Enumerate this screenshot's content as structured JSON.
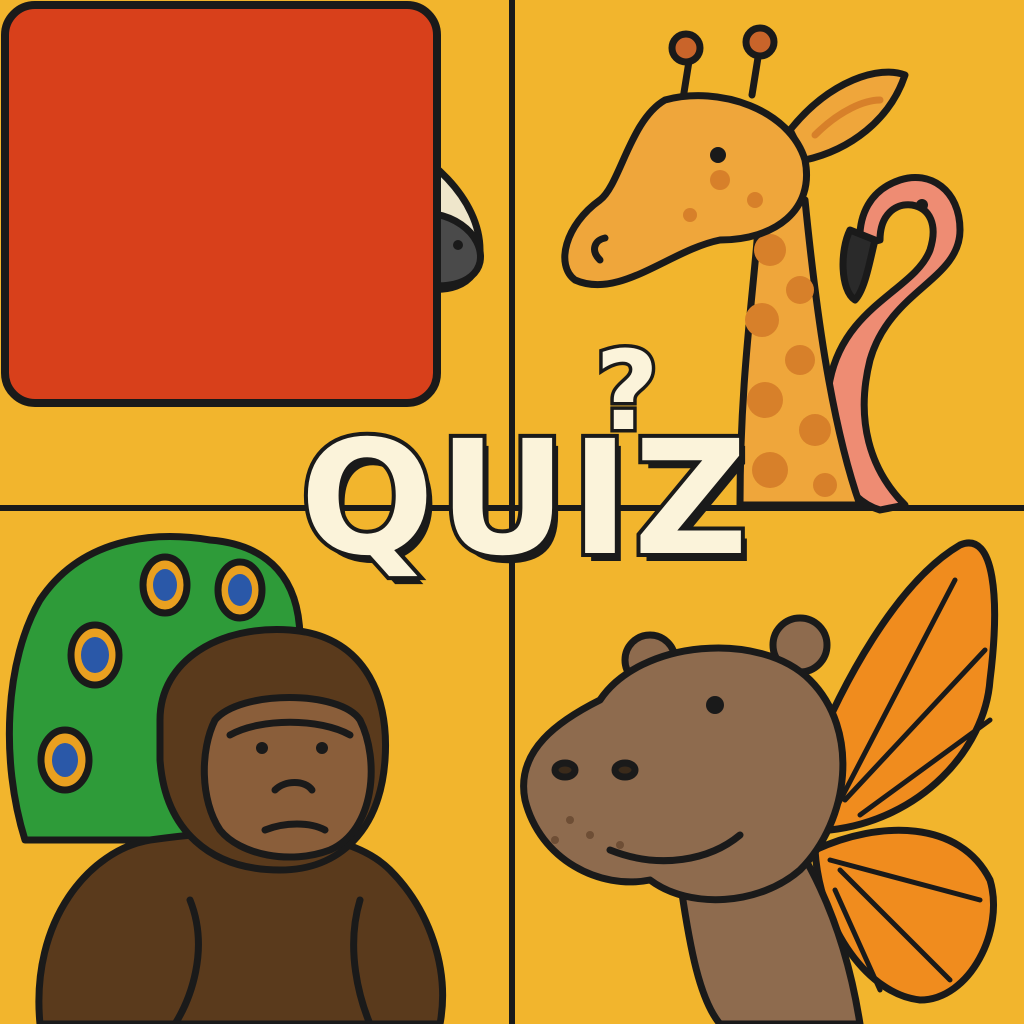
{
  "quiz": {
    "title": "QUIZ",
    "mark": "?"
  },
  "colors": {
    "background": "#F2B52D",
    "card": "#D8401B",
    "outline": "#1a1a1a",
    "lettering": "#FBF3DA"
  },
  "panels": [
    {
      "name": "zebra-fish-panel",
      "icon": "zebra-fish-icon"
    },
    {
      "name": "giraffe-flamingo-panel",
      "icon": "giraffe-flamingo-icon"
    },
    {
      "name": "gorilla-peacock-panel",
      "icon": "gorilla-peacock-icon"
    },
    {
      "name": "hippo-butterfly-panel",
      "icon": "hippo-butterfly-icon"
    }
  ]
}
